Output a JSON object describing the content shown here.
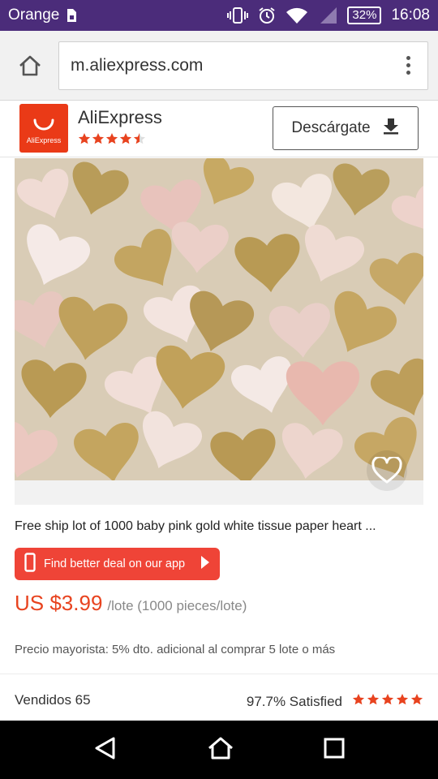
{
  "status_bar": {
    "carrier": "Orange",
    "battery": "32%",
    "time": "16:08",
    "icons": [
      "sim-icon",
      "vibrate-icon",
      "alarm-icon",
      "wifi-icon",
      "signal-icon",
      "battery-icon"
    ]
  },
  "browser": {
    "url": "m.aliexpress.com",
    "icons": [
      "home-icon",
      "overflow-menu-icon"
    ]
  },
  "app_banner": {
    "logo_text": "AliExpress",
    "name": "AliExpress",
    "rating": 4.5,
    "download_label": "Descárgate",
    "colors": {
      "logo_bg": "#ea3a17",
      "star": "#e8431f"
    }
  },
  "product": {
    "image_alt": "pink gold white tissue paper hearts",
    "title": "Free ship lot of 1000 baby pink gold white tissue paper heart ...",
    "deal_label": "Find better deal on our app",
    "price": "US $3.99",
    "unit": "/lote (1000 pieces/lote)",
    "wholesale": "Precio mayorista: 5% dto. adicional al comprar 5 lote o más",
    "sold": "Vendidos 65",
    "satisfied": "97.7% Satisfied",
    "satisfied_stars": 5,
    "colors": {
      "price": "#e8431f",
      "deal_bg": "#ef4437"
    }
  },
  "nav_bar": {
    "icons": [
      "back-icon",
      "home-nav-icon",
      "recents-icon"
    ]
  }
}
